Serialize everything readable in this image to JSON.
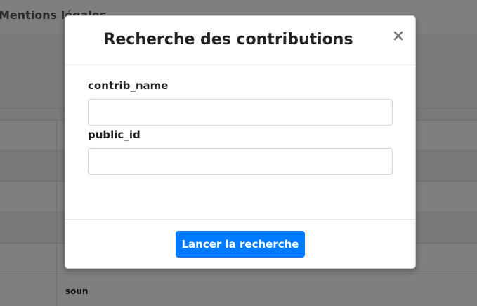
{
  "background": {
    "header_link": "Mentions légales",
    "table_cell": "soun"
  },
  "modal": {
    "title": "Recherche des contributions",
    "close_icon": "close-icon",
    "fields": [
      {
        "label": "contrib_name",
        "value": "",
        "placeholder": ""
      },
      {
        "label": "public_id",
        "value": "",
        "placeholder": ""
      }
    ],
    "submit_label": "Lancer la recherche"
  },
  "colors": {
    "primary": "#007bff",
    "overlay": "rgba(0,0,0,0.5)"
  }
}
